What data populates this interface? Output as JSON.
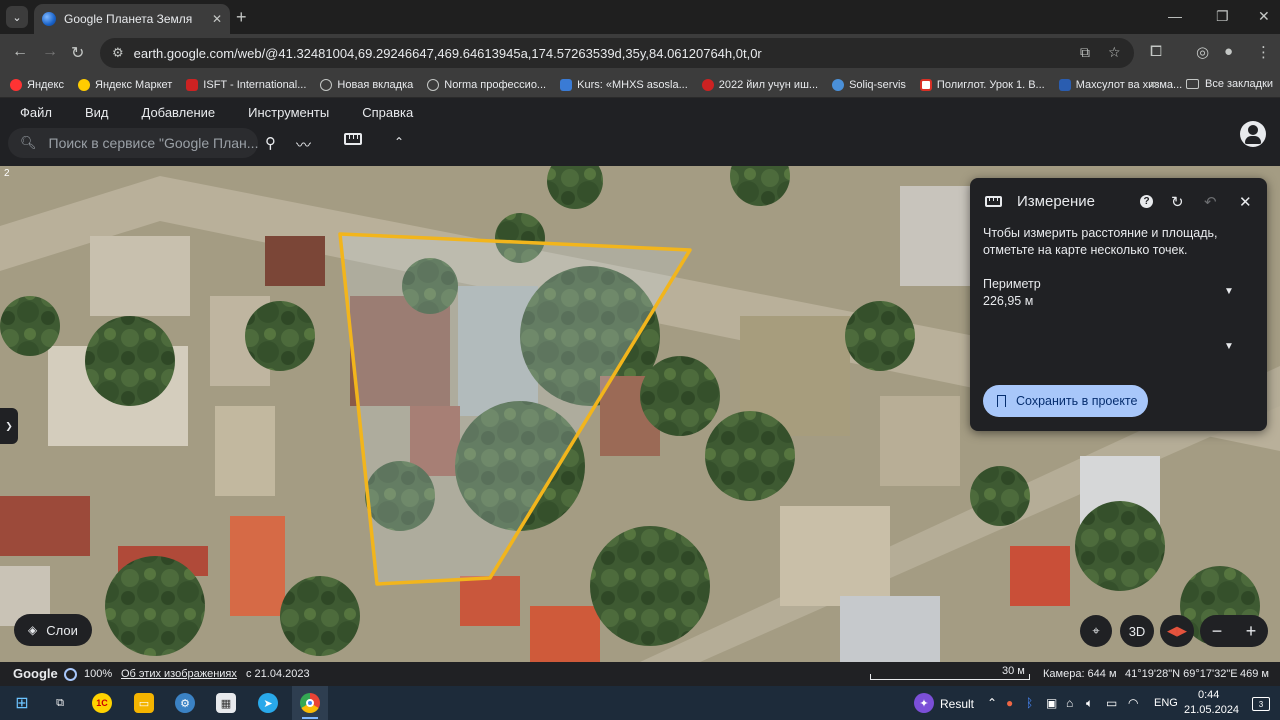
{
  "browser": {
    "tab": {
      "title": "Google Планета Земля",
      "favicon": "globe-icon"
    },
    "window_controls": [
      "minimize",
      "maximize",
      "close"
    ],
    "address": {
      "url": "earth.google.com/web/@41.32481004,69.29246647,469.64613945a,174.57263539d,35y,84.06120764h,0t,0r"
    },
    "bookmarks": [
      {
        "label": "Яндекс",
        "color": "#ff3333"
      },
      {
        "label": "Яндекс Маркет",
        "color": "#ffcc00"
      },
      {
        "label": "ISFT - International...",
        "color": "#cc2222"
      },
      {
        "label": "Новая вкладка",
        "color": "#c4c7c5"
      },
      {
        "label": "Norma профессио...",
        "color": "#c4c7c5"
      },
      {
        "label": "Kurs: «MHXS asosla...",
        "color": "#3a7bd5"
      },
      {
        "label": "2022 йил учун иш...",
        "color": "#cc2222"
      },
      {
        "label": "Soliq-servis",
        "color": "#4a90d9"
      },
      {
        "label": "Полиглот. Урок 1. В...",
        "color": "#d93025"
      },
      {
        "label": "Махсулот ва хизма...",
        "color": "#2a5db0"
      }
    ],
    "bookmarks_more": "»",
    "all_bookmarks": "Все закладки"
  },
  "earth": {
    "menu": [
      "Файл",
      "Вид",
      "Добавление",
      "Инструменты",
      "Справка"
    ],
    "search_placeholder": "Поиск в сервисе \"Google План...",
    "measure_panel": {
      "title": "Измерение",
      "description": "Чтобы измерить расстояние и площадь, отметьте на карте несколько точек.",
      "perimeter_label": "Периметр",
      "perimeter_value": "226,95 м",
      "save_button": "Сохранить в проекте"
    },
    "layers_button": "Слои",
    "view_3d": "3D",
    "corner_number": "2",
    "status": {
      "brand": "Google",
      "zoom": "100%",
      "about_images": "Об этих изображениях",
      "date": "с 21.04.2023",
      "scale": "30 м",
      "camera": "Камера: 644 м",
      "coordinates": "41°19'28\"N 69°17'32\"E",
      "elevation": "469 м"
    },
    "polygon_color": "#f2b51c"
  },
  "taskbar": {
    "pinned_apps": [
      "windows-start",
      "task-view",
      "1c-app",
      "file-explorer",
      "control-panel",
      "calculator",
      "telegram",
      "chrome"
    ],
    "weather_label": "Result",
    "language": "ENG",
    "time": "0:44",
    "date": "21.05.2024",
    "notifications": "3"
  }
}
